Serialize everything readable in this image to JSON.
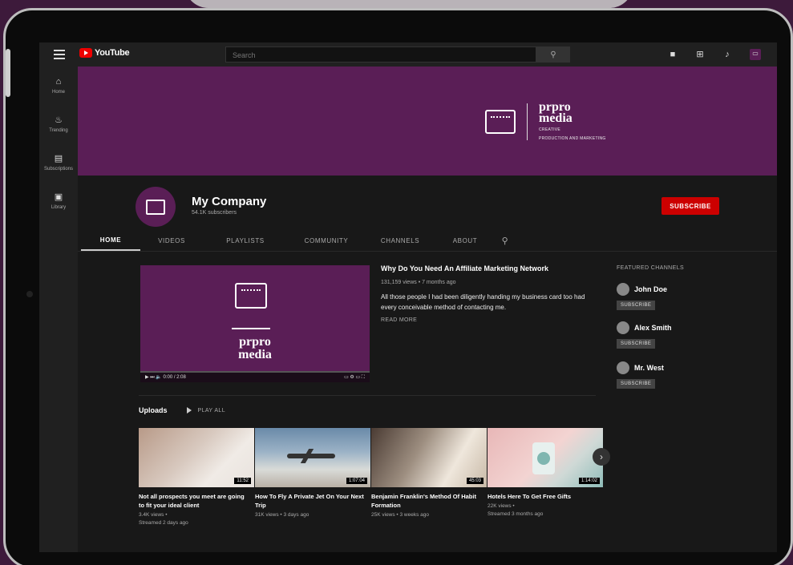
{
  "topbar": {
    "logo_text": "YouTube",
    "search_placeholder": "Search"
  },
  "sidebar": {
    "items": [
      {
        "label": "Home",
        "icon": "home-icon"
      },
      {
        "label": "Trending",
        "icon": "trending-icon"
      },
      {
        "label": "Subscriptions",
        "icon": "subscriptions-icon"
      },
      {
        "label": "Library",
        "icon": "library-icon"
      }
    ]
  },
  "banner": {
    "brand_line1": "prpro",
    "brand_line2": "media",
    "tagline_line1": "CREATIVE",
    "tagline_line2": "PRODUCTION AND MARKETING"
  },
  "channel": {
    "name": "My Company",
    "subscribers": "54.1K subscribers",
    "subscribe_label": "SUBSCRIBE"
  },
  "tabs": [
    {
      "label": "HOME",
      "active": true
    },
    {
      "label": "VIDEOS"
    },
    {
      "label": "PLAYLISTS"
    },
    {
      "label": "COMMUNITY"
    },
    {
      "label": "CHANNELS"
    },
    {
      "label": "ABOUT"
    }
  ],
  "featured_video": {
    "brand_line1": "prpro",
    "brand_line2": "media",
    "time": "0:00 / 2:08",
    "title": "Why Do You Need An Affiliate Marketing Network",
    "meta": "131,159 views • 7 months ago",
    "description": "All those people I had been diligently handing my business card too had every conceivable method of contacting me.",
    "read_more": "READ MORE"
  },
  "featured_channels": {
    "heading": "FEATURED CHANNELS",
    "items": [
      {
        "name": "John Doe",
        "button": "SUBSCRIBE"
      },
      {
        "name": "Alex Smith",
        "button": "SUBSCRIBE"
      },
      {
        "name": "Mr. West",
        "button": "SUBSCRIBE"
      }
    ]
  },
  "uploads": {
    "title": "Uploads",
    "play_all": "PLAY ALL",
    "videos": [
      {
        "title": "Not all prospects you meet are going to fit your ideal client",
        "duration": "11:52",
        "meta1": "3.4K views •",
        "meta2": "Streamed 2 days ago"
      },
      {
        "title": "How To Fly A Private Jet On Your Next Trip",
        "duration": "1:07:04",
        "meta1": "31K views • 3 days ago",
        "meta2": ""
      },
      {
        "title": "Benjamin Franklin's Method Of Habit Formation",
        "duration": "45:03",
        "meta1": "25K views • 3 weeks ago",
        "meta2": ""
      },
      {
        "title": "Hotels Here To Get Free Gifts",
        "duration": "1:14:02",
        "meta1": "22K views •",
        "meta2": "Streamed 3 months ago"
      }
    ]
  },
  "colors": {
    "brand_purple": "#5a1e56",
    "subscribe_red": "#cc0000",
    "page_bg": "#181818"
  }
}
